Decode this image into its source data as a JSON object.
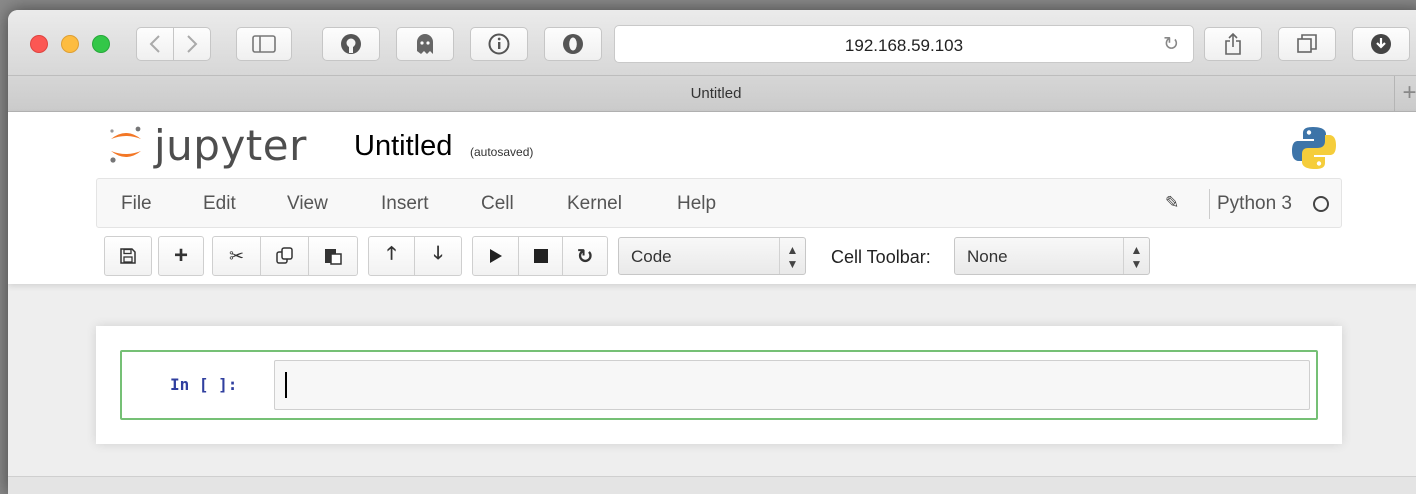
{
  "browser": {
    "url": "192.168.59.103",
    "tab_title": "Untitled",
    "new_tab_symbol": "+"
  },
  "notebook": {
    "logo_text": "jupyter",
    "name": "Untitled",
    "autosave_status": "(autosaved)"
  },
  "menu": {
    "items": [
      "File",
      "Edit",
      "View",
      "Insert",
      "Cell",
      "Kernel",
      "Help"
    ],
    "kernel_name": "Python 3"
  },
  "toolbar": {
    "cell_type": "Code",
    "cell_toolbar_label": "Cell Toolbar:",
    "cell_toolbar_value": "None"
  },
  "cell": {
    "prompt": "In [ ]:",
    "content": ""
  },
  "colors": {
    "jupyter_orange": "#f37726",
    "cell_selected_border": "#75c075",
    "prompt_color": "#303f9f",
    "close": "#fc5753",
    "minimize": "#fdbc40",
    "maximize": "#33c748"
  }
}
